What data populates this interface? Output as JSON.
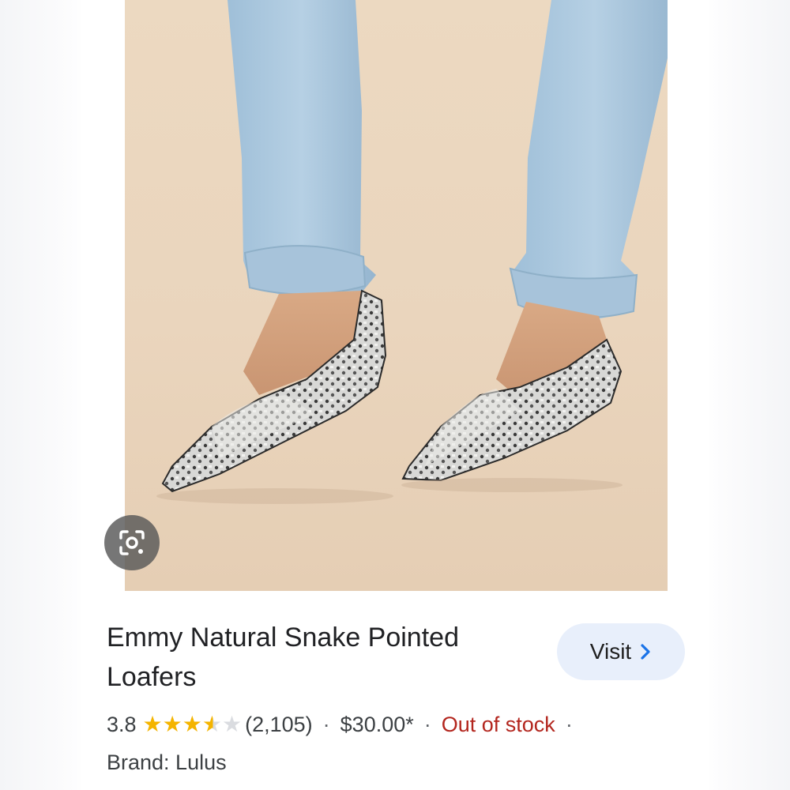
{
  "product": {
    "image_alt": "Snake print pointed loafers worn with light wash jeans",
    "title": "Emmy Natural Snake Pointed Loafers",
    "rating": "3.8",
    "rating_value": 3.8,
    "rating_max": 5,
    "review_count": "(2,105)",
    "price": "$30.00*",
    "availability": "Out of stock",
    "separator": "·",
    "brand": "Brand: Lulus"
  },
  "actions": {
    "visit_label": "Visit",
    "lens_icon": "google-lens-icon",
    "chevron_icon": "chevron-right-icon"
  },
  "colors": {
    "accent_blue": "#1a73e8",
    "visit_bg": "#e8effb",
    "star_yellow": "#f4b400",
    "stock_red": "#b3261e"
  }
}
